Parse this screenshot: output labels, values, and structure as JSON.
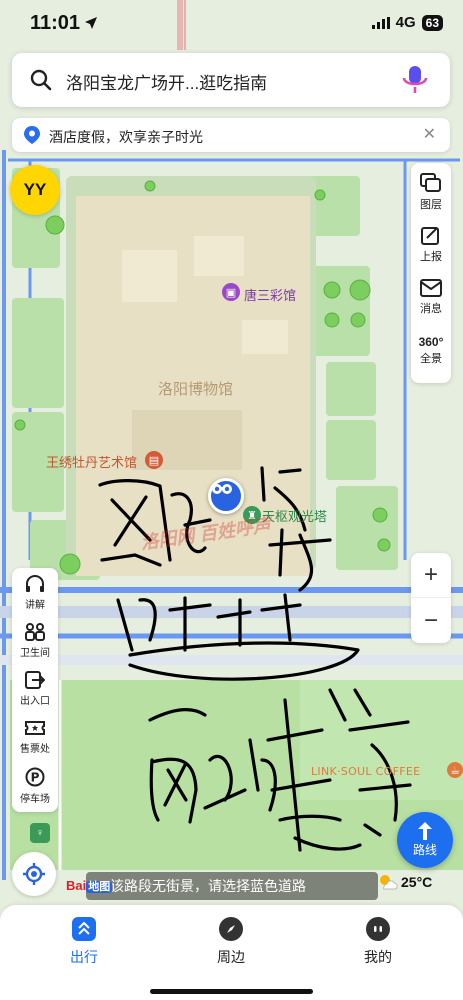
{
  "status_bar": {
    "time": "11:01",
    "network": "4G",
    "battery": "63"
  },
  "search": {
    "text": "洛阳宝龙广场开...逛吃指南"
  },
  "banner": {
    "text": "酒店度假，欢享亲子时光"
  },
  "yy_badge": "YY",
  "right_tools": [
    {
      "label": "图层",
      "icon": "layers-icon"
    },
    {
      "label": "上报",
      "icon": "report-icon"
    },
    {
      "label": "消息",
      "icon": "mail-icon"
    },
    {
      "label": "全景",
      "icon": "panorama-360-icon",
      "badge": "360°"
    }
  ],
  "zoom": {
    "in": "+",
    "out": "−"
  },
  "left_tools": [
    {
      "label": "讲解",
      "icon": "headphones-icon"
    },
    {
      "label": "卫生间",
      "icon": "restroom-icon"
    },
    {
      "label": "出入口",
      "icon": "exit-icon"
    },
    {
      "label": "售票处",
      "icon": "ticket-icon"
    },
    {
      "label": "停车场",
      "icon": "parking-icon"
    }
  ],
  "map": {
    "museum": "洛阳博物馆",
    "poi_tangsancai": "唐三彩馆",
    "poi_wangxiu": "王绣牡丹艺术馆",
    "poi_tower": "天枢观光塔",
    "poi_coffee": "LINK·SOUL COFFEE"
  },
  "route_button": "路线",
  "map_hint": "该路段无街景，请选择蓝色道路",
  "baidu_logo": {
    "text": "Bai",
    "badge": "地图"
  },
  "weather": {
    "temp": "25°C"
  },
  "bottom_nav": [
    {
      "label": "出行",
      "active": true
    },
    {
      "label": "周边",
      "active": false
    },
    {
      "label": "我的",
      "active": false
    }
  ],
  "watermark": "洛阳网 百姓呼声",
  "colors": {
    "accent": "#1e6ff0",
    "road": "#5b8df0",
    "park": "#b9e0a8",
    "museum_block": "#e7e0c4",
    "yy": "#ffd600",
    "ink": "#000000"
  }
}
